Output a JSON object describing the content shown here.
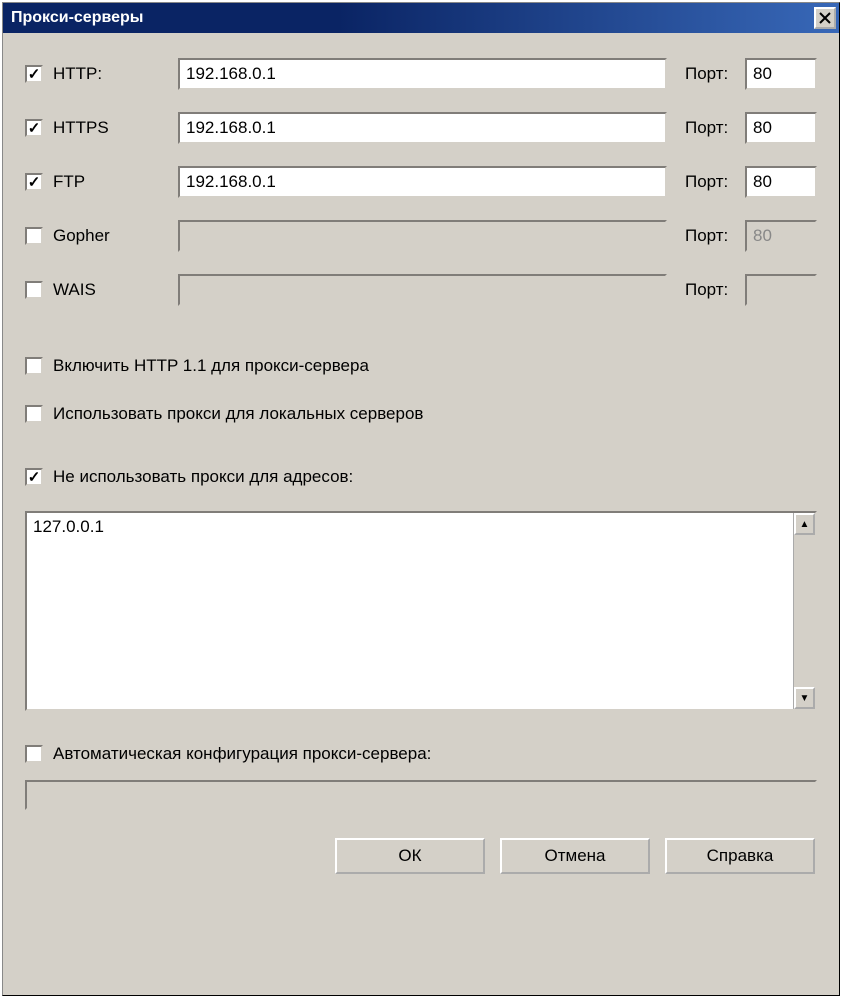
{
  "title": "Прокси-серверы",
  "port_label": "Порт:",
  "proxies": [
    {
      "name": "HTTP:",
      "checked": true,
      "addr": "192.168.0.1",
      "port": "80",
      "enabled": true
    },
    {
      "name": "HTTPS",
      "checked": true,
      "addr": "192.168.0.1",
      "port": "80",
      "enabled": true
    },
    {
      "name": "FTP",
      "checked": true,
      "addr": "192.168.0.1",
      "port": "80",
      "enabled": true
    },
    {
      "name": "Gopher",
      "checked": false,
      "addr": "",
      "port": "80",
      "enabled": false
    },
    {
      "name": "WAIS",
      "checked": false,
      "addr": "",
      "port": "",
      "enabled": false
    }
  ],
  "options": {
    "http11": {
      "checked": false,
      "label": "Включить HTTP 1.1 для прокси-сервера"
    },
    "local": {
      "checked": false,
      "label": "Использовать прокси для локальных серверов"
    },
    "exclude": {
      "checked": true,
      "label": "Не использовать прокси для адресов:"
    },
    "autocfg": {
      "checked": false,
      "label": "Автоматическая конфигурация прокси-сервера:"
    }
  },
  "exclude_text": "127.0.0.1",
  "autocfg_url": "",
  "buttons": {
    "ok": "ОК",
    "cancel": "Отмена",
    "help": "Справка"
  }
}
